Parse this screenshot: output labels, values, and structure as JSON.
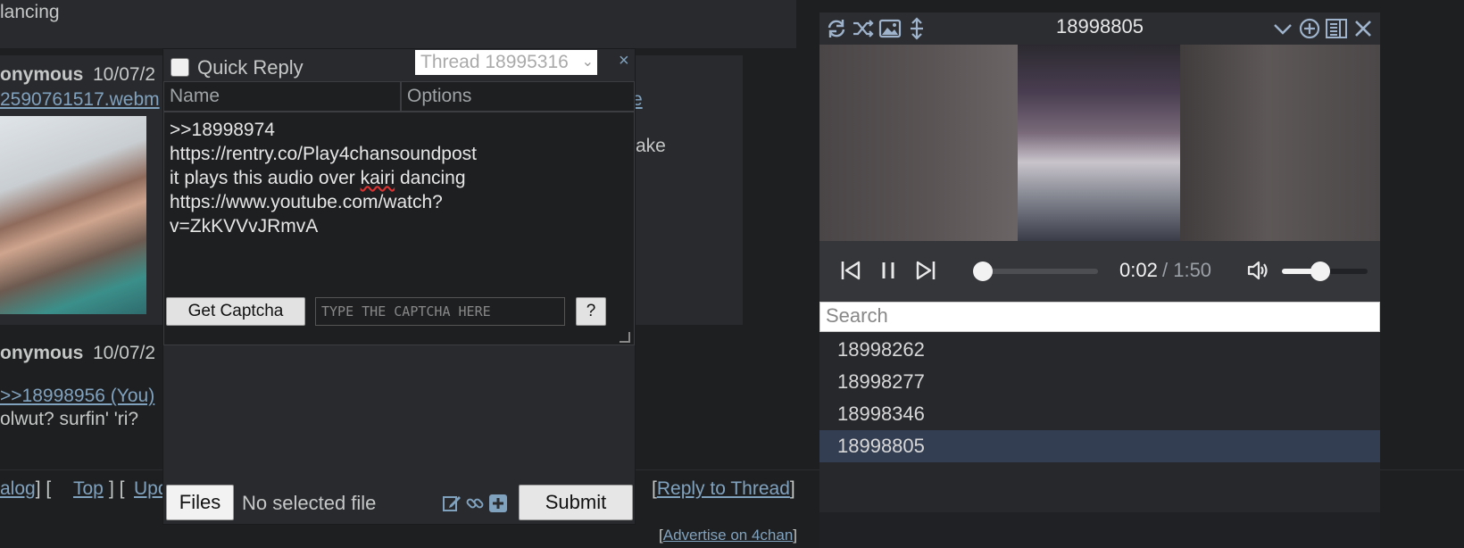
{
  "thread": {
    "top_text": "lancing",
    "post1": {
      "name": "onymous",
      "date": "10/07/2",
      "file_link": "2590761517.webm",
      "right_link": "e",
      "right_text": "ake"
    },
    "post2": {
      "name": "onymous",
      "date": "10/07/2",
      "quote": ">>18998956 (You)",
      "text": "olwut? surfin' 'ri?"
    },
    "nav": {
      "catalog": "alog",
      "top": "Top",
      "update": "Updat",
      "reply_to_thread": "Reply to Thread"
    },
    "advertise": "Advertise on 4chan"
  },
  "quick_reply": {
    "title": "Quick Reply",
    "thread_select": "Thread 18995316",
    "close": "×",
    "name_placeholder": "Name",
    "options_placeholder": "Options",
    "comment_lines": [
      ">>18998974",
      "https://rentry.co/Play4chansoundpost",
      "it plays this audio over kairi dancing",
      "https://www.youtube.com/watch?",
      "v=ZkKVVvJRmvA"
    ],
    "captcha_button": "Get Captcha",
    "captcha_placeholder": "TYPE THE CAPTCHA HERE",
    "captcha_help": "?",
    "files_button": "Files",
    "file_status": "No selected file",
    "submit": "Submit",
    "icons": [
      "edit-icon",
      "link-icon",
      "plus-box-icon"
    ]
  },
  "player": {
    "title": "18998805",
    "header_icons": [
      "reload-icon",
      "shuffle-icon",
      "image-icon",
      "expand-vertical-icon",
      "chevron-down-icon",
      "add-circle-icon",
      "playlist-icon",
      "close-icon"
    ],
    "time_current": "0:02",
    "time_total": "/ 1:50",
    "progress_fraction": 0.02,
    "volume_fraction": 0.45,
    "search_placeholder": "Search",
    "playlist": [
      {
        "label": "18998262",
        "active": false
      },
      {
        "label": "18998277",
        "active": false
      },
      {
        "label": "18998346",
        "active": false
      },
      {
        "label": "18998805",
        "active": true
      }
    ]
  },
  "colors": {
    "page_bg": "#1d1f21",
    "post_bg": "#282a2e",
    "link": "#81a2be",
    "active_row": "#343e52"
  }
}
